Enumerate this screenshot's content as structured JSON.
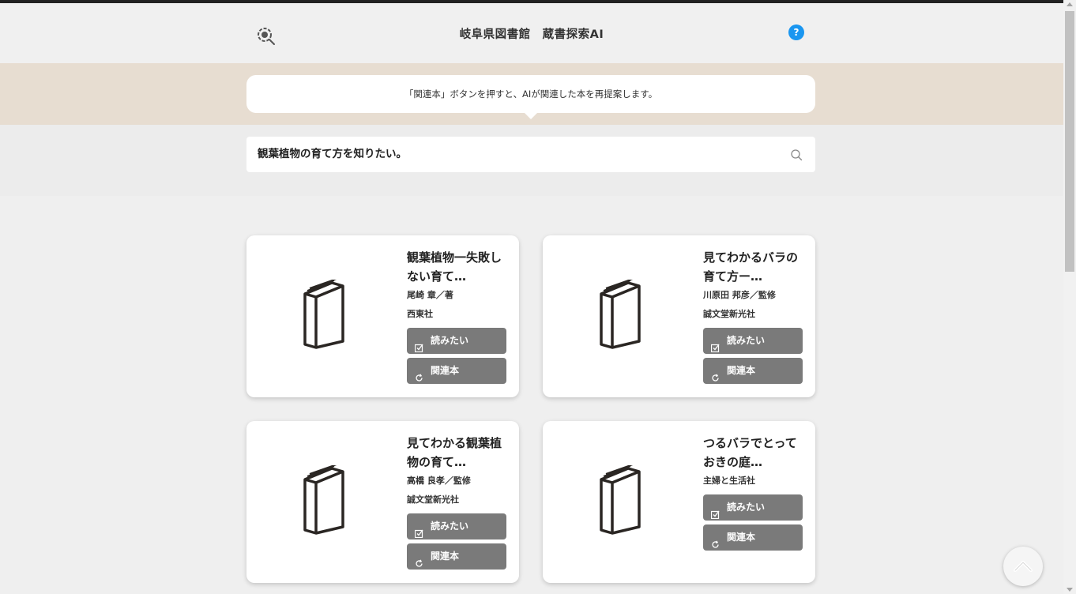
{
  "header": {
    "title": "岐阜県図書館　蔵書探索AI",
    "help_label": "?",
    "logo_icon": "magnifier-logo-icon"
  },
  "notice": {
    "text": "「関連本」ボタンを押すと、AIが関連した本を再提案します。"
  },
  "search": {
    "value": "観葉植物の育て方を知りたい。",
    "icon": "search-icon"
  },
  "books": [
    {
      "title": "観葉植物一失敗しない育て…",
      "author": "尾崎 章／著",
      "publisher": "西東社",
      "want_label": "読みたい",
      "related_label": "関連本"
    },
    {
      "title": "見てわかるバラの育て方ー…",
      "author": "川原田 邦彦／監修",
      "publisher": "誠文堂新光社",
      "want_label": "読みたい",
      "related_label": "関連本"
    },
    {
      "title": "見てわかる観葉植物の育て…",
      "author": "高橋 良孝／監修",
      "publisher": "誠文堂新光社",
      "want_label": "読みたい",
      "related_label": "関連本"
    },
    {
      "title": "つるバラでとっておきの庭…",
      "author": "",
      "publisher": "主婦と生活社",
      "want_label": "読みたい",
      "related_label": "関連本"
    }
  ],
  "colors": {
    "accent_help": "#1a96f0",
    "notice_band": "#e7ddd1",
    "button_bg": "#7a7a7a"
  }
}
